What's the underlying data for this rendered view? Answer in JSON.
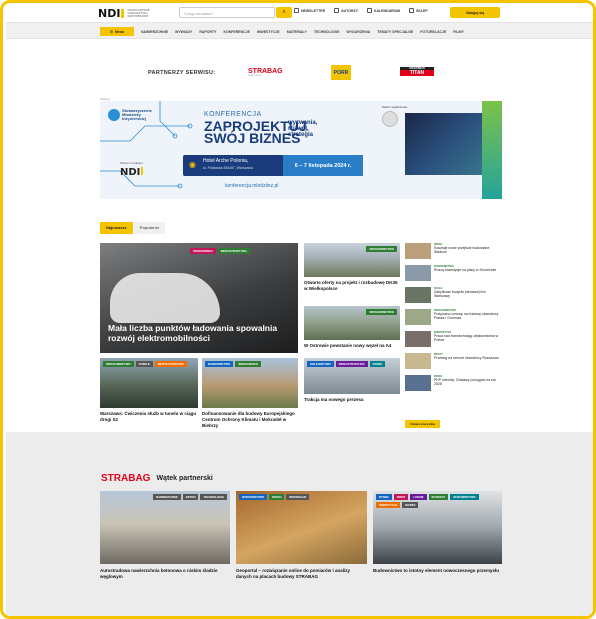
{
  "header": {
    "logo": "NDI",
    "logo_sub": "NOWOCZESNE DORADZTWO INŻYNIERSKIE",
    "search_placeholder": "Czego szukasz?",
    "search_icon": "search-icon",
    "links": [
      {
        "label": "Newsletter",
        "icon": "mail-icon"
      },
      {
        "label": "Autorzy",
        "icon": "people-icon"
      },
      {
        "label": "Kalendarium",
        "icon": "calendar-icon"
      },
      {
        "label": "Sklep",
        "icon": "cart-icon"
      }
    ],
    "login_label": "Zaloguj się"
  },
  "nav": {
    "menu_label": "Menu",
    "items": [
      "Nawierzchnie",
      "Wywiady",
      "Raporty",
      "Konferencje",
      "Inwestycje",
      "Materiały",
      "Technologie",
      "Wydarzenia",
      "Tematy specjalne",
      "Fotorelacje",
      "Filmy"
    ]
  },
  "partners": {
    "label": "PARTNERZY SERWISU:",
    "strabag": "STRABAG",
    "strabag_sub": "TEAMS WORK",
    "porr": "PORR",
    "titan_top": "SCHERBECK",
    "titan": "TITAN"
  },
  "banner": {
    "ad_label": "Reklama",
    "org_name": "Stowarzyszenie Młodzieży Inżynierskiej",
    "partner_media_label": "Partner medialny:",
    "ndi": "NDI",
    "konf": "KONFERENCJA",
    "big_line1": "ZAPROJEKTUJ",
    "big_line2": "SWÓJ BIZNES",
    "tagline": "wyzwania, rozwój, strategia",
    "venue": "Hotel Arche Polonia,",
    "address": "ul. Puławska 85A/87, Warszawa",
    "date": "6 – 7 listopada 2024 r.",
    "url": "konferencja.mlodziinz.pl",
    "patron_label": "Patron wydarzenia:"
  },
  "tabs": [
    "Najnowsze",
    "Popularne"
  ],
  "hero": {
    "title": "Mała liczba punktów ładowania spowalnia rozwój elektromobilności",
    "badges": [
      {
        "label": "Środowisko",
        "cls": "b-red"
      },
      {
        "label": "Infrastruktura",
        "cls": "b-green"
      }
    ]
  },
  "cards": [
    {
      "title": "Otwarte oferty na projekt i rozbudowę DK35 w Wielkopolsce",
      "badges": [
        "Drogownictwo"
      ]
    },
    {
      "title": "W Ostrowie powstanie nowy węzeł na A4",
      "badges": [
        "Drogownictwo"
      ]
    },
    {
      "title": "Warszawa: Ćwiczenia służb w tunelu w ciągu drogi S2",
      "badges": [
        "Drogownictwo",
        "Tunele",
        "Bezpieczeństwo"
      ]
    },
    {
      "title": "Dofinansowanie dla budowy Europejskiego Centrum Ochrony Klimatu i Mokradeł w Biebrzy",
      "badges": [
        "Budownictwo",
        "Środowisko"
      ]
    },
    {
      "title": "Trakcja ma nowego prezesa",
      "badges": [
        "Kolejnictwo",
        "Infrastruktura",
        "Rynek"
      ]
    }
  ],
  "rlist": [
    {
      "cat": "Drogi",
      "title": "Kosztuje nowe przejście budowlane Stadium"
    },
    {
      "cat": "Budownictwo",
      "title": "Ruszą inwestycje na placy w Szczecinie"
    },
    {
      "cat": "Kolej",
      "title": "Zabytkowe budynki pierwszej linii Warszawy"
    },
    {
      "cat": "Drogownictwo",
      "title": "Podpisano umowę na budowę obwodnicy Piaska i Gorzowa"
    },
    {
      "cat": "Energetyka",
      "title": "Praca nad transformacją ciepłownictwa w Polsce"
    },
    {
      "cat": "Mosty",
      "title": "Przetarg na remont obwodnicy Rzeszowa"
    },
    {
      "cat": "Drogi",
      "title": "PKP Intercity: Dostawy pociągów na rok 2025"
    }
  ],
  "more_label": "Zobacz wszystkie",
  "partner_section": {
    "brand": "STRABAG",
    "heading": "Wątek partnerski",
    "cards": [
      {
        "title": "Autostradowa nawierzchnia betonowa o niskim śladzie węglowym",
        "badges": [
          "Nawierzchnie",
          "Beton",
          "Technologie"
        ]
      },
      {
        "title": "Geoportal – rozwiązanie online do pomiarów i analizy danych na placach budowy STRABAG",
        "badges": [
          "Budownictwo",
          "Drogi",
          "Innowacje"
        ]
      },
      {
        "title": "Budownictwo to istotny element nowoczesnego przemysłu",
        "badges": [
          "Rynek",
          "Firmy",
          "Ludzie",
          "Wywiady",
          "Budownictwo",
          "Inwestycje",
          "Biznes"
        ]
      }
    ]
  },
  "colors": {
    "accent": "#f5c400",
    "brand_red": "#e2001a",
    "navy": "#1a3c7c"
  }
}
